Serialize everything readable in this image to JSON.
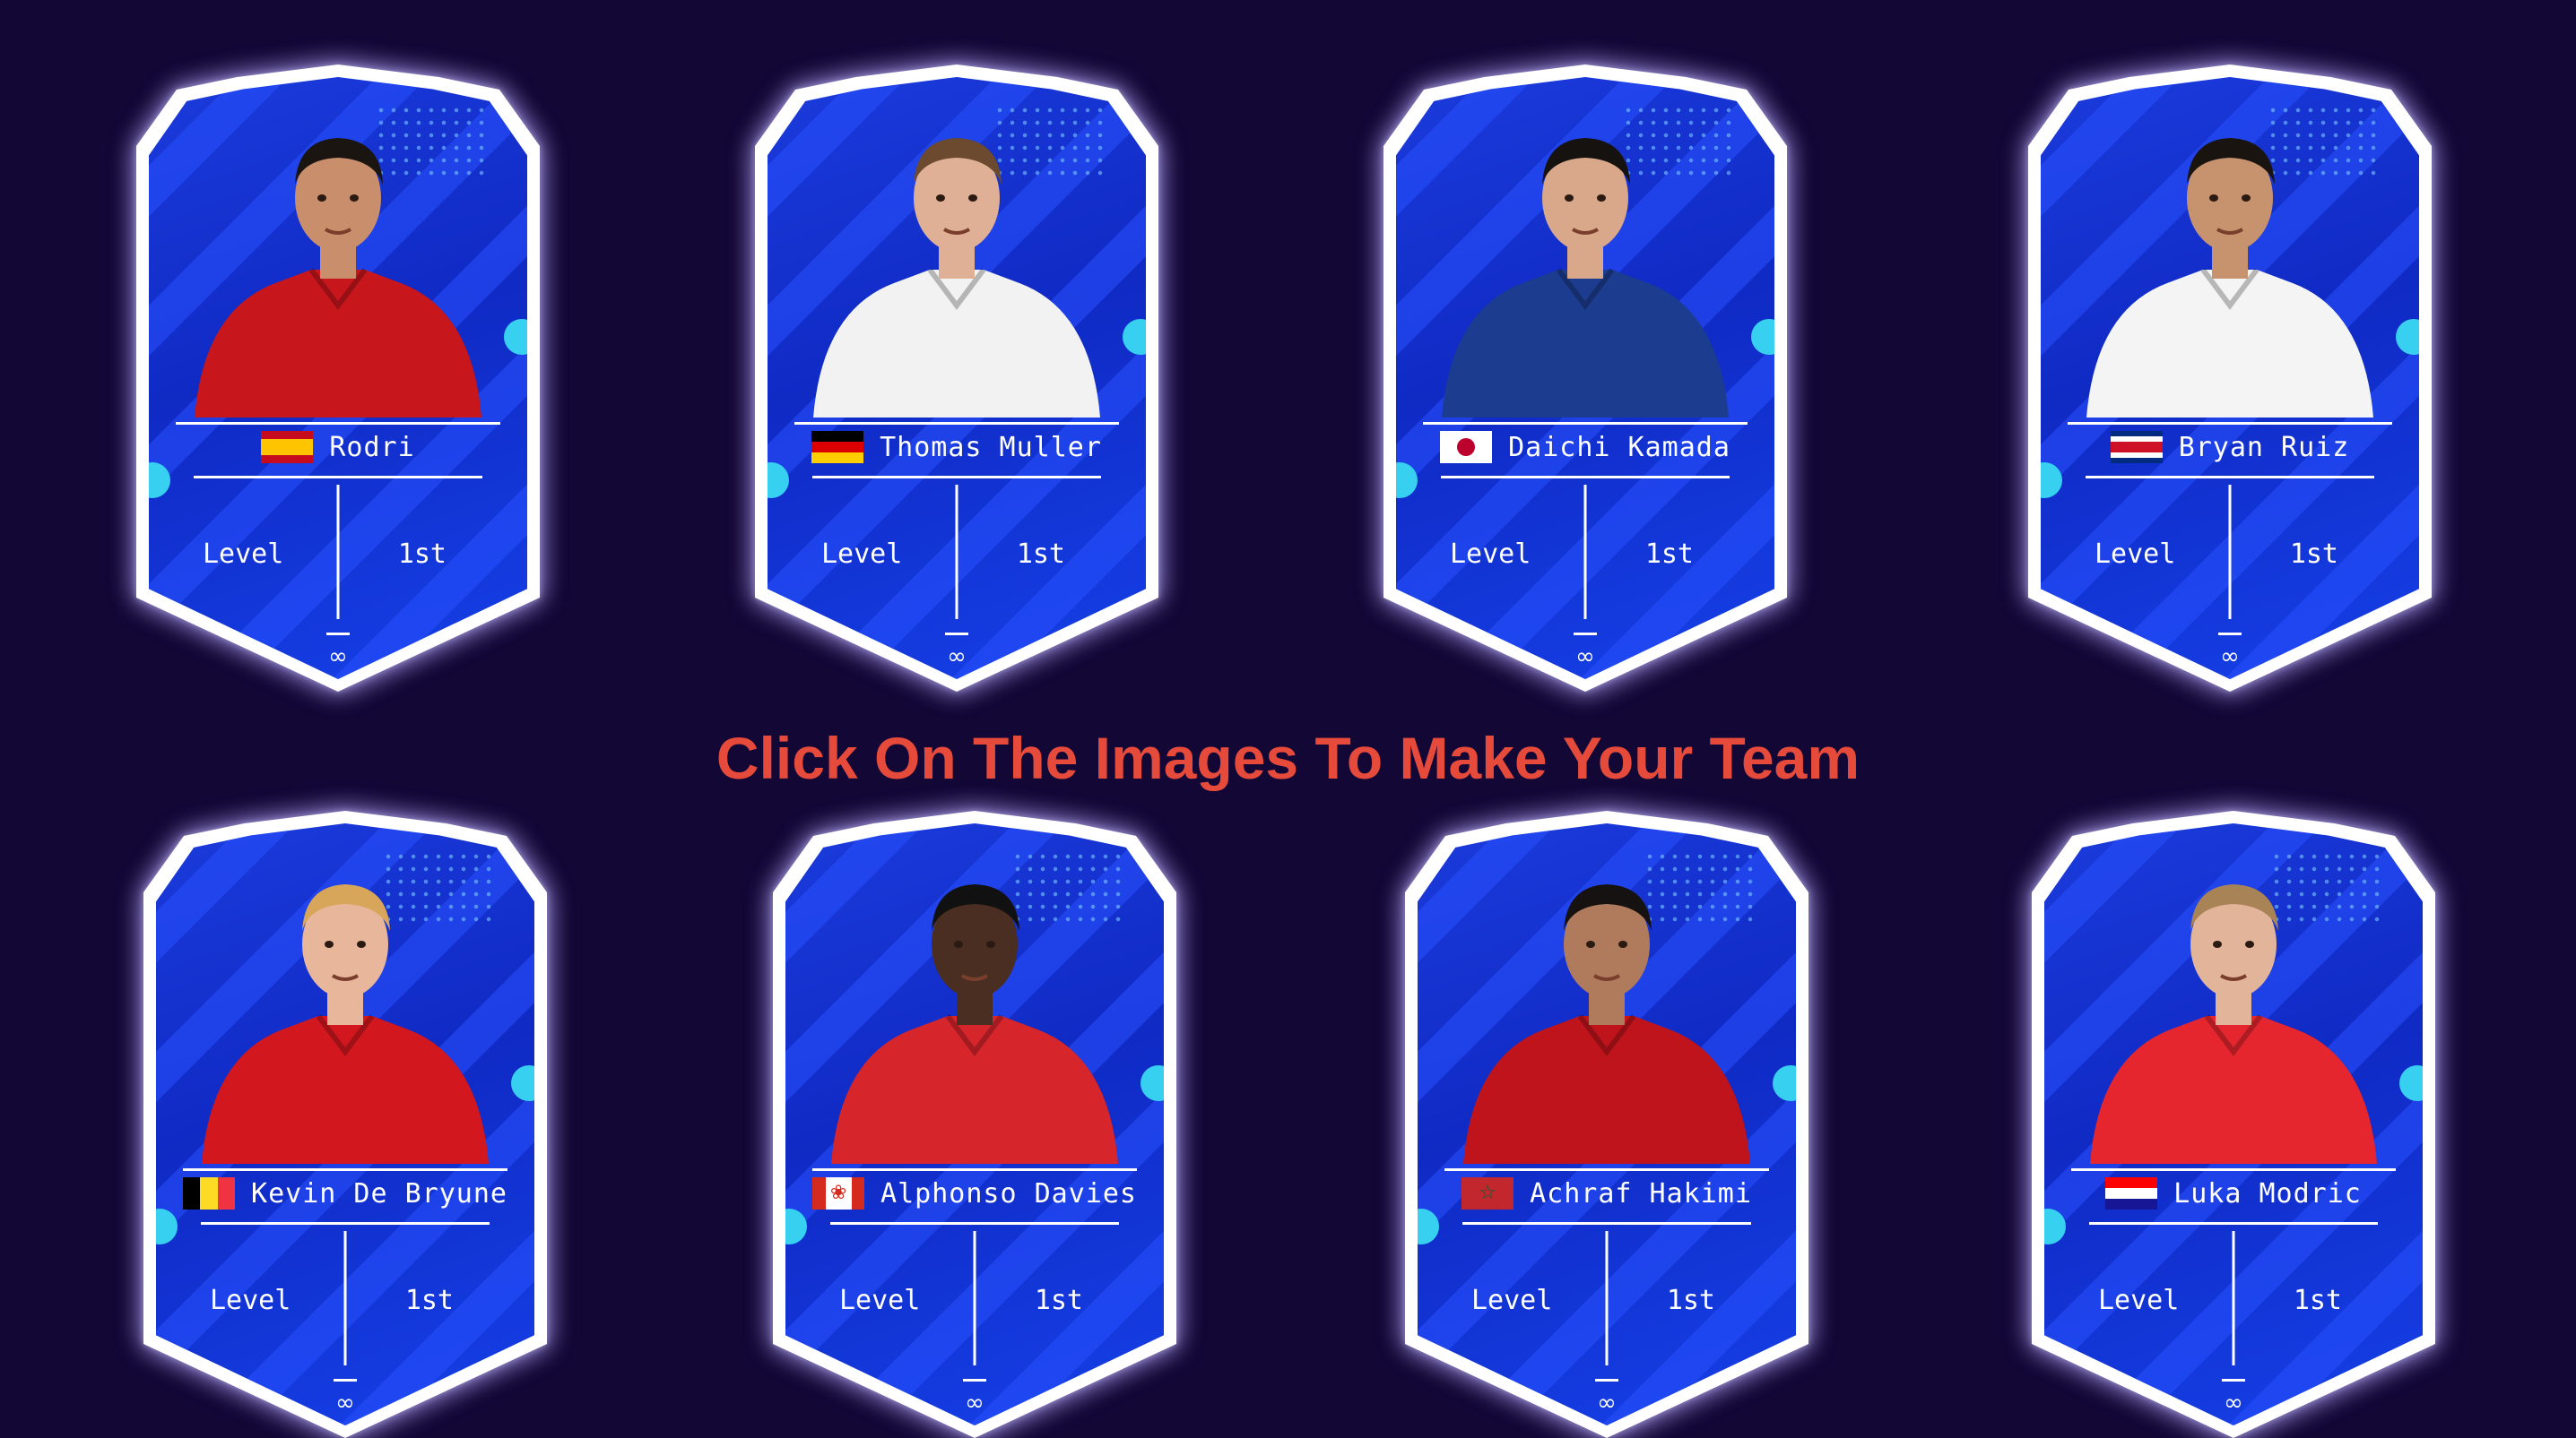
{
  "headline": "Click On The Images To Make Your Team",
  "cards": [
    {
      "name": "Rodri",
      "level_label": "Level",
      "rank": "1st",
      "flag": "spain",
      "kit": "#c8161d",
      "skin": "#c98f6c",
      "hair": "#1b1511"
    },
    {
      "name": "Thomas Muller",
      "level_label": "Level",
      "rank": "1st",
      "flag": "germany",
      "kit": "#f2f2f2",
      "skin": "#e0b096",
      "hair": "#6b4a2f"
    },
    {
      "name": "Daichi Kamada",
      "level_label": "Level",
      "rank": "1st",
      "flag": "japan",
      "kit": "#1c3d8f",
      "skin": "#d9a789",
      "hair": "#151210"
    },
    {
      "name": "Bryan Ruiz",
      "level_label": "Level",
      "rank": "1st",
      "flag": "costa-rica",
      "kit": "#f4f4f4",
      "skin": "#c7936f",
      "hair": "#1a1410"
    },
    {
      "name": "Kevin De Bryune",
      "level_label": "Level",
      "rank": "1st",
      "flag": "belgium",
      "kit": "#d3171e",
      "skin": "#e8b79b",
      "hair": "#d8a65a"
    },
    {
      "name": "Alphonso Davies",
      "level_label": "Level",
      "rank": "1st",
      "flag": "canada",
      "kit": "#d7252c",
      "skin": "#4a2e22",
      "hair": "#111111"
    },
    {
      "name": "Achraf Hakimi",
      "level_label": "Level",
      "rank": "1st",
      "flag": "morocco",
      "kit": "#c0141c",
      "skin": "#b07b5c",
      "hair": "#161211"
    },
    {
      "name": "Luka Modric",
      "level_label": "Level",
      "rank": "1st",
      "flag": "croatia",
      "kit": "#e6262e",
      "skin": "#e2b49a",
      "hair": "#a88356"
    }
  ],
  "icons": {
    "emblem": "infinity-emblem-icon",
    "bubble": "decor-bubble-icon"
  }
}
